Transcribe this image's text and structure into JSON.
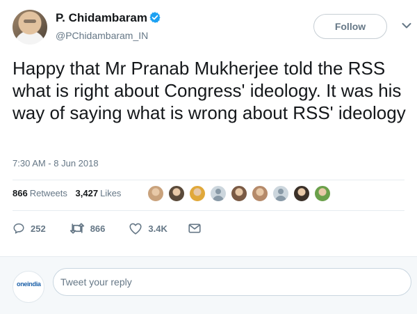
{
  "author": {
    "display_name": "P. Chidambaram",
    "handle": "@PChidambaram_IN",
    "verified": true
  },
  "follow_button": {
    "label": "Follow"
  },
  "tweet": {
    "text": "Happy that Mr Pranab Mukherjee told the RSS what is right about Congress' ideology. It was his way of saying what is wrong about RSS' ideology",
    "timestamp": "7:30 AM - 8 Jun 2018"
  },
  "stats": {
    "retweets_count": "866",
    "retweets_label": "Retweets",
    "likes_count": "3,427",
    "likes_label": "Likes"
  },
  "likers": [
    {
      "kind": "photo",
      "color": "#c9a27c"
    },
    {
      "kind": "photo",
      "color": "#5a4a3a"
    },
    {
      "kind": "photo",
      "color": "#e0a83a"
    },
    {
      "kind": "default",
      "color": "#ccd6dd"
    },
    {
      "kind": "photo",
      "color": "#7a5a44"
    },
    {
      "kind": "photo",
      "color": "#b58a6a"
    },
    {
      "kind": "default",
      "color": "#ccd6dd"
    },
    {
      "kind": "photo",
      "color": "#3a3028"
    },
    {
      "kind": "photo",
      "color": "#6aa04a"
    }
  ],
  "actions": {
    "replies": "252",
    "retweets": "866",
    "likes": "3.4K"
  },
  "reply": {
    "placeholder": "Tweet your reply",
    "logo_text": "oneindia"
  },
  "colors": {
    "verified_blue": "#1da1f2",
    "secondary_text": "#657786",
    "primary_text": "#14171a"
  },
  "icons": {
    "verified": "verified-badge-icon",
    "chevron": "chevron-down-icon",
    "reply": "reply-icon",
    "retweet": "retweet-icon",
    "like": "heart-icon",
    "dm": "envelope-icon"
  }
}
